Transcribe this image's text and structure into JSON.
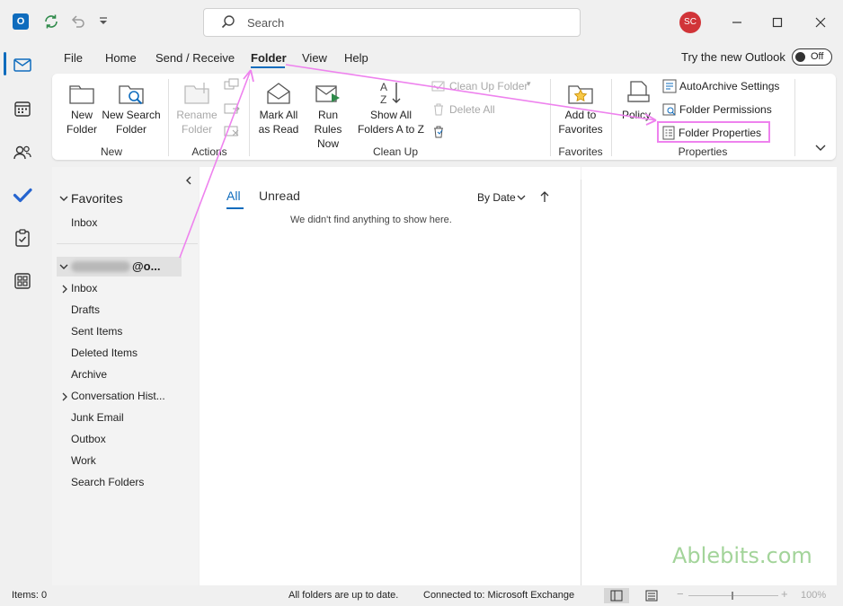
{
  "titlebar": {
    "app_icon_letter": "O",
    "search_placeholder": "Search",
    "avatar_initials": "SC",
    "icons": [
      "outlook-icon",
      "sync-icon",
      "undo-icon",
      "customize-qat-icon",
      "minimize-icon",
      "maximize-icon",
      "close-icon"
    ]
  },
  "menu": {
    "tabs": [
      "File",
      "Home",
      "Send / Receive",
      "Folder",
      "View",
      "Help"
    ],
    "active_tab": "Folder",
    "try_new_label": "Try the new Outlook",
    "toggle_label": "Off"
  },
  "ribbon": {
    "new_folder": [
      "New",
      "Folder"
    ],
    "new_search_folder": [
      "New Search",
      "Folder"
    ],
    "group_new": "New",
    "rename_folder": [
      "Rename",
      "Folder"
    ],
    "group_actions": "Actions",
    "mark_all_read": [
      "Mark All",
      "as Read"
    ],
    "run_rules": [
      "Run Rules",
      "Now"
    ],
    "show_all_folders": [
      "Show All",
      "Folders A to Z"
    ],
    "clean_up_folder": "Clean Up Folder",
    "delete_all": "Delete All",
    "group_cleanup": "Clean Up",
    "add_to_favorites": [
      "Add to",
      "Favorites"
    ],
    "group_favorites": "Favorites",
    "policy": "Policy",
    "autoarchive": "AutoArchive Settings",
    "folder_permissions": "Folder Permissions",
    "folder_properties": "Folder Properties",
    "group_properties": "Properties"
  },
  "nav": {
    "favorites_label": "Favorites",
    "favorites_items": [
      "Inbox"
    ],
    "account_suffix": "@o...",
    "folders": [
      "Inbox",
      "Drafts",
      "Sent Items",
      "Deleted Items",
      "Archive",
      "Conversation Hist...",
      "Junk Email",
      "Outbox",
      "Work",
      "Search Folders"
    ]
  },
  "list": {
    "tab_all": "All",
    "tab_unread": "Unread",
    "sort_label": "By Date",
    "empty_message": "We didn't find anything to show here."
  },
  "status": {
    "items": "Items: 0",
    "sync": "All folders are up to date.",
    "connection": "Connected to: Microsoft Exchange",
    "zoom": "100%"
  },
  "watermark": "Ablebits.com",
  "colors": {
    "accent": "#0f6cbd",
    "highlight": "#ee82ee",
    "avatar": "#d13438"
  }
}
